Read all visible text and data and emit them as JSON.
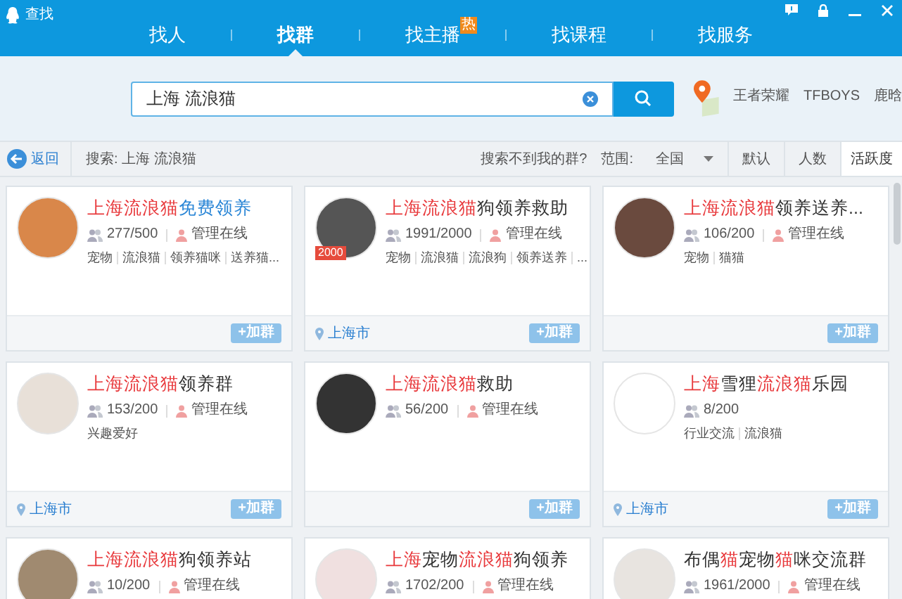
{
  "window": {
    "title": "查找"
  },
  "tabs": [
    {
      "label": "找人",
      "selected": false
    },
    {
      "label": "找群",
      "selected": true
    },
    {
      "label": "找主播",
      "selected": false,
      "badge": "热"
    },
    {
      "label": "找课程",
      "selected": false
    },
    {
      "label": "找服务",
      "selected": false
    }
  ],
  "search": {
    "value": "上海 流浪猫",
    "hot_keywords": [
      "王者荣耀",
      "TFBOYS",
      "鹿晗"
    ]
  },
  "filter_bar": {
    "back": "返回",
    "query": "搜索: 上海 流浪猫",
    "not_found": "搜索不到我的群?",
    "range_label": "范围:",
    "range_value": "全国",
    "sorts": [
      {
        "label": "默认",
        "selected": false
      },
      {
        "label": "人数",
        "selected": false
      },
      {
        "label": "活跃度",
        "selected": true
      }
    ]
  },
  "groups": [
    {
      "title": [
        {
          "text": "上海流浪猫",
          "kind": "match"
        },
        {
          "text": "免费领养",
          "kind": "link"
        }
      ],
      "members": "277/500",
      "admin": "管理在线",
      "tags": [
        "宠物",
        "流浪猫",
        "领养猫咪",
        "送养猫..."
      ],
      "join": "+加群"
    },
    {
      "title": [
        {
          "text": "上海流浪猫",
          "kind": "match"
        },
        {
          "text": "狗领养救助",
          "kind": "plain"
        }
      ],
      "members": "1991/2000",
      "admin": "管理在线",
      "tags": [
        "宠物",
        "流浪猫",
        "流浪狗",
        "领养送养",
        "..."
      ],
      "badge": "2000",
      "location": "上海市",
      "join": "+加群"
    },
    {
      "title": [
        {
          "text": "上海流浪猫",
          "kind": "match"
        },
        {
          "text": "领养送养...",
          "kind": "plain"
        }
      ],
      "members": "106/200",
      "admin": "管理在线",
      "tags": [
        "宠物",
        "猫猫"
      ],
      "join": "+加群"
    },
    {
      "title": [
        {
          "text": "上海流浪猫",
          "kind": "match"
        },
        {
          "text": "领养群",
          "kind": "plain"
        }
      ],
      "members": "153/200",
      "admin": "管理在线",
      "tags": [
        "兴趣爱好"
      ],
      "location": "上海市",
      "join": "+加群"
    },
    {
      "title": [
        {
          "text": "上海流浪猫",
          "kind": "match"
        },
        {
          "text": "救助",
          "kind": "plain"
        }
      ],
      "members": "56/200",
      "admin": "管理在线",
      "join": "+加群"
    },
    {
      "title": [
        {
          "text": "上海",
          "kind": "match"
        },
        {
          "text": "雪狸",
          "kind": "plain"
        },
        {
          "text": "流浪猫",
          "kind": "match"
        },
        {
          "text": "乐园",
          "kind": "plain"
        }
      ],
      "members": "8/200",
      "tags": [
        "行业交流",
        "流浪猫"
      ],
      "location": "上海市",
      "join": "+加群"
    },
    {
      "title": [
        {
          "text": "上海流浪猫",
          "kind": "match"
        },
        {
          "text": "狗领养站",
          "kind": "plain"
        }
      ],
      "members": "10/200",
      "admin": "管理在线"
    },
    {
      "title": [
        {
          "text": "上海",
          "kind": "match"
        },
        {
          "text": "宠物",
          "kind": "plain"
        },
        {
          "text": "流浪猫",
          "kind": "match"
        },
        {
          "text": "狗领养",
          "kind": "plain"
        }
      ],
      "members": "1702/200",
      "admin": "管理在线"
    },
    {
      "title": [
        {
          "text": "布偶",
          "kind": "plain"
        },
        {
          "text": "猫",
          "kind": "match"
        },
        {
          "text": "宠物",
          "kind": "plain"
        },
        {
          "text": "猫",
          "kind": "match"
        },
        {
          "text": "咪交流群",
          "kind": "plain"
        }
      ],
      "members": "1961/2000",
      "admin": "管理在线"
    }
  ]
}
